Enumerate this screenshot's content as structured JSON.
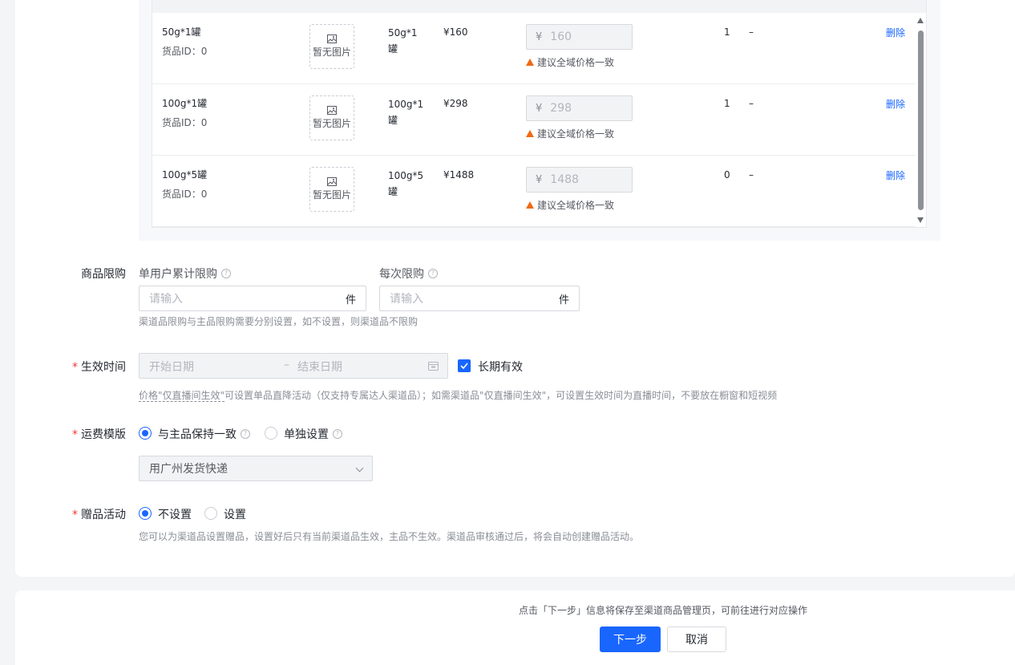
{
  "sku_rows": [
    {
      "name": "50g*1罐",
      "goods_id": "货品ID：0",
      "image_text": "暂无图片",
      "spec": "50g*1罐",
      "price": "¥160",
      "channel_price": "160",
      "warning": "建议全域价格一致",
      "stock": "1",
      "extra": "–",
      "action": "删除"
    },
    {
      "name": "100g*1罐",
      "goods_id": "货品ID：0",
      "image_text": "暂无图片",
      "spec": "100g*1罐",
      "price": "¥298",
      "channel_price": "298",
      "warning": "建议全域价格一致",
      "stock": "1",
      "extra": "–",
      "action": "删除"
    },
    {
      "name": "100g*5罐",
      "goods_id": "货品ID：0",
      "image_text": "暂无图片",
      "spec": "100g*5罐",
      "price": "¥1488",
      "channel_price": "1488",
      "warning": "建议全域价格一致",
      "stock": "0",
      "extra": "–",
      "action": "删除"
    }
  ],
  "currency_symbol": "¥",
  "purchase_limit": {
    "label": "商品限购",
    "per_user_label": "单用户累计限购",
    "per_order_label": "每次限购",
    "placeholder": "请输入",
    "unit": "件",
    "hint": "渠道品限购与主品限购需要分别设置，如不设置，则渠道品不限购"
  },
  "effective_time": {
    "label": "生效时间",
    "start_placeholder": "开始日期",
    "separator": "–",
    "end_placeholder": "结束日期",
    "long_term_label": "长期有效",
    "long_term_checked": true,
    "hint_underlined": "价格\"仅直播间生效\"",
    "hint_rest": "可设置单品直降活动（仅支持专属达人渠道品）；如需渠道品\"仅直播间生效\"，可设置生效时间为直播时间，不要放在橱窗和短视频"
  },
  "shipping": {
    "label": "运费模版",
    "option_same": "与主品保持一致",
    "option_custom": "单独设置",
    "selected": "same",
    "template": "用广州发货快递"
  },
  "gift": {
    "label": "赠品活动",
    "option_none": "不设置",
    "option_set": "设置",
    "selected": "none",
    "hint": "您可以为渠道品设置赠品，设置好后只有当前渠道品生效，主品不生效。渠道品审核通过后，将会自动创建赠品活动。"
  },
  "footer": {
    "note": "点击「下一步」信息将保存至渠道商品管理页，可前往进行对应操作",
    "next_label": "下一步",
    "cancel_label": "取消"
  },
  "colors": {
    "primary": "#1966ff",
    "warning": "#f06a14",
    "required": "#f03a3a"
  }
}
